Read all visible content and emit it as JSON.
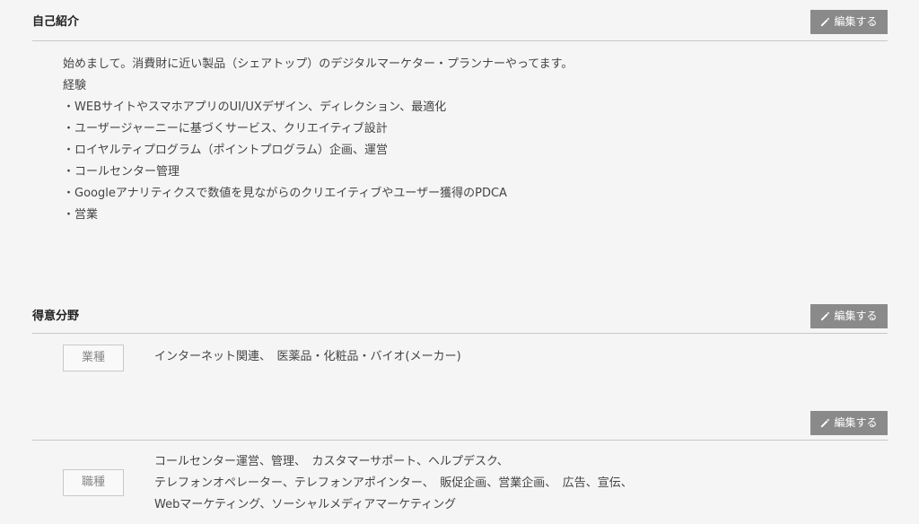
{
  "self_intro": {
    "title": "自己紹介",
    "edit_label": "編集する",
    "lines": [
      "始めまして。消費財に近い製品（シェアトップ）のデジタルマーケター・プランナーやってます。",
      "経験",
      "・WEBサイトやスマホアプリのUI/UXデザイン、ディレクション、最適化",
      "・ユーザージャーニーに基づくサービス、クリエイティブ設計",
      "・ロイヤルティプログラム（ポイントプログラム）企画、運営",
      "・コールセンター管理",
      "・Googleアナリティクスで数値を見ながらのクリエイティブやユーザー獲得のPDCA",
      "・営業"
    ]
  },
  "specialty": {
    "title": "得意分野",
    "industry": {
      "edit_label": "編集する",
      "tag": "業種",
      "lines": [
        "インターネット関連、　医薬品・化粧品・バイオ(メーカー)"
      ]
    },
    "job_type": {
      "edit_label": "編集する",
      "tag": "職種",
      "lines": [
        "コールセンター運営、管理、　カスタマーサポート、ヘルプデスク、",
        "テレフォンオペレーター、テレフォンアポインター、　販促企画、営業企画、　広告、宣伝、",
        "Webマーケティング、ソーシャルメディアマーケティング"
      ]
    }
  },
  "icons": {
    "edit": "pencil-icon"
  },
  "colors": {
    "background": "#f5f5f5",
    "button": "#8a8a8a",
    "divider": "#c8c8c8"
  }
}
